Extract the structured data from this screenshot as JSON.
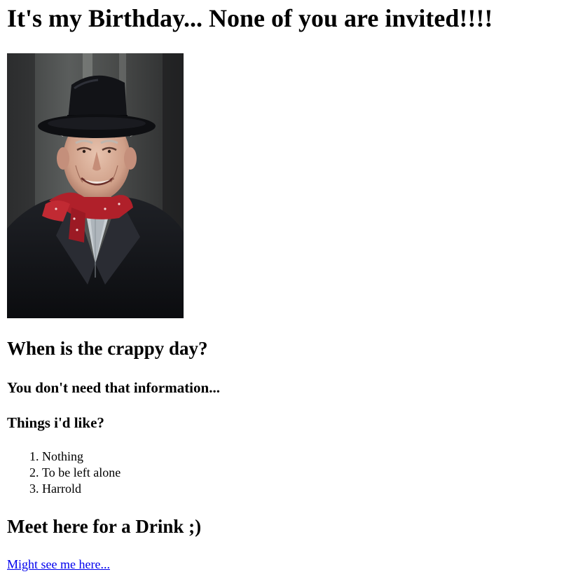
{
  "page": {
    "title": "It's my Birthday... None of you are invited!!!!",
    "photo_alt": "Old man in a black hat and coat with a red scarf"
  },
  "when": {
    "heading": "When is the crappy day?",
    "answer": "You don't need that information..."
  },
  "wishes": {
    "heading": "Things i'd like?",
    "items": [
      "Nothing",
      "To be left alone",
      "Harrold"
    ]
  },
  "drink": {
    "heading": "Meet here for a Drink ;)",
    "link_label": "Might see me here..."
  },
  "colors": {
    "link": "#0000ee",
    "text": "#000000",
    "background": "#ffffff",
    "scarf": "#b0202a",
    "coat": "#141519"
  }
}
